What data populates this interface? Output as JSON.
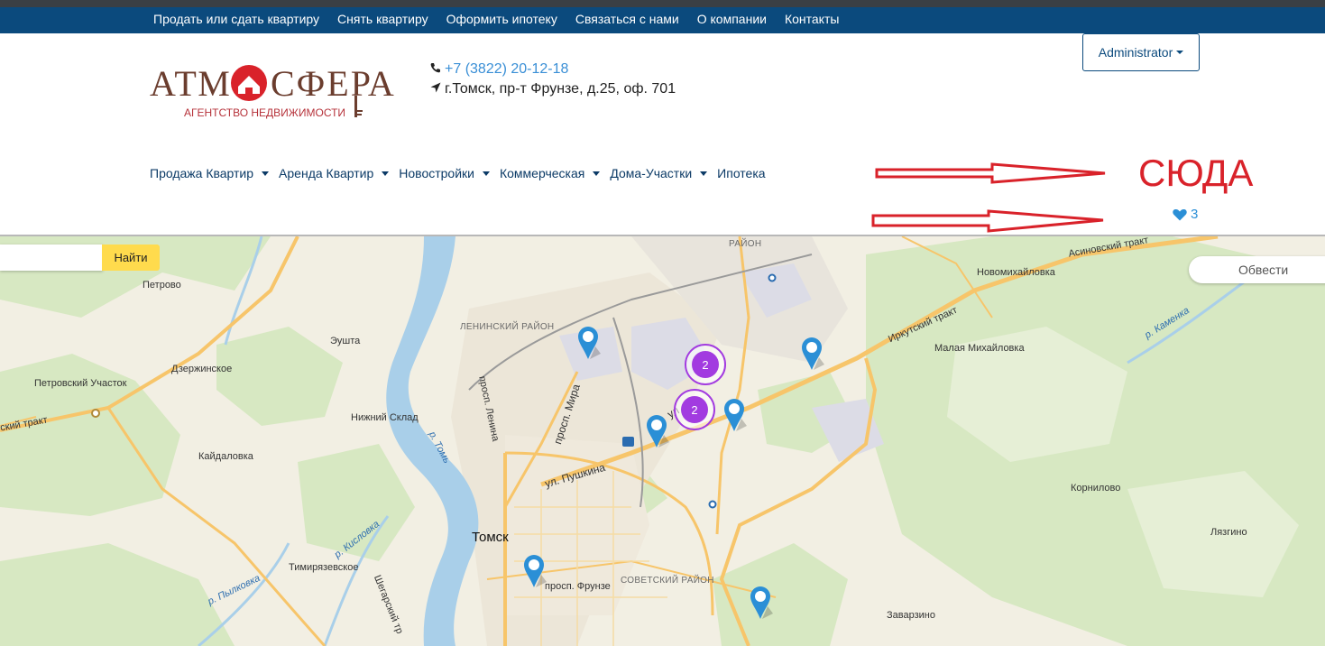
{
  "topnav": {
    "items": [
      {
        "label": "Продать или сдать квартиру"
      },
      {
        "label": "Снять квартиру"
      },
      {
        "label": "Оформить ипотеку"
      },
      {
        "label": "Связаться с нами"
      },
      {
        "label": "О компании"
      },
      {
        "label": "Контакты"
      }
    ]
  },
  "header": {
    "logo_main": "АТМ СФЕРА",
    "logo_sub": "АГЕНТСТВО НЕДВИЖИМОСТИ",
    "phone": "+7 (3822) 20-12-18",
    "address": "г.Томск, пр-т Фрунзе, д.25, оф. 701",
    "admin_label": "Administrator"
  },
  "mainnav": {
    "items": [
      {
        "label": "Продажа Квартир",
        "dropdown": true
      },
      {
        "label": "Аренда Квартир",
        "dropdown": true
      },
      {
        "label": "Новостройки",
        "dropdown": true
      },
      {
        "label": "Коммерческая",
        "dropdown": true
      },
      {
        "label": "Дома-Участки",
        "dropdown": true
      },
      {
        "label": "Ипотека",
        "dropdown": false
      }
    ]
  },
  "annotation": {
    "text": "СЮДА",
    "color": "#d9222a"
  },
  "favorites": {
    "icon": "heart-icon",
    "count": "3"
  },
  "map": {
    "search_placeholder": "",
    "find_label": "Найти",
    "outline_label": "Обвести",
    "labels": {
      "petrovo": "Петрово",
      "eushta": "Эушта",
      "dzerzhinskoe": "Дзержинское",
      "petrovskiy": "Петровский Участок",
      "nizhniy": "Нижний Склад",
      "kaydalovka": "Кайдаловка",
      "leninskiy": "ЛЕНИНСКИЙ РАЙОН",
      "oktyabrskiy": "РАЙОН",
      "sovetskiy": "СОВЕТСКИЙ РАЙОН",
      "tomsk": "Томск",
      "timiryazevskoe": "Тимирязевское",
      "novomikhaylovka": "Новомихайловка",
      "malaya": "Малая Михайловка",
      "kornilovo": "Корнилово",
      "lyazgino": "Лязгино",
      "zavarzino": "Заварзино",
      "tom": "р. Томь",
      "kislovka": "р. Кисловка",
      "pylkovka": "р. Пылковка",
      "kamenka": "р. Каменка",
      "prosp_mira": "просп. Мира",
      "prosp_lenina": "просп. Ленина",
      "pushkina": "ул. Пушкина",
      "frunze": "просп. Фрунзе",
      "irkutskiy": "Иркутский тракт",
      "asinovskiy": "Асиновский тракт",
      "shegarskiy": "Шегарский тр",
      "trakt_left": "ский тракт",
      "ul": "ул"
    },
    "clusters": [
      {
        "count": "2"
      },
      {
        "count": "2"
      }
    ],
    "colors": {
      "land": "#f2efe3",
      "forest": "#d7e8c2",
      "water": "#a9cfe9",
      "road": "#f7c56a",
      "pin": "#2b8fd6",
      "cluster": "#a23be0"
    }
  }
}
